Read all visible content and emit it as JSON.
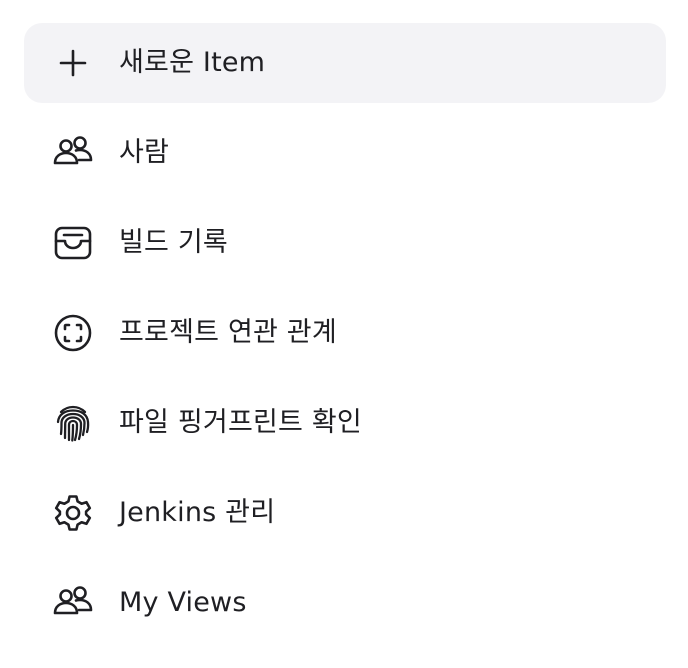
{
  "tasks": [
    {
      "label": "새로운 Item",
      "icon": "plus-icon"
    },
    {
      "label": "사람",
      "icon": "people-icon"
    },
    {
      "label": "빌드 기록",
      "icon": "inbox-icon"
    },
    {
      "label": "프로젝트 연관 관계",
      "icon": "scan-circle-icon"
    },
    {
      "label": "파일 핑거프린트 확인",
      "icon": "fingerprint-icon"
    },
    {
      "label": "Jenkins 관리",
      "icon": "gear-icon"
    },
    {
      "label": "My Views",
      "icon": "people-icon"
    }
  ],
  "colors": {
    "text": "#1f1f23",
    "active_background": "#f3f3f6"
  }
}
